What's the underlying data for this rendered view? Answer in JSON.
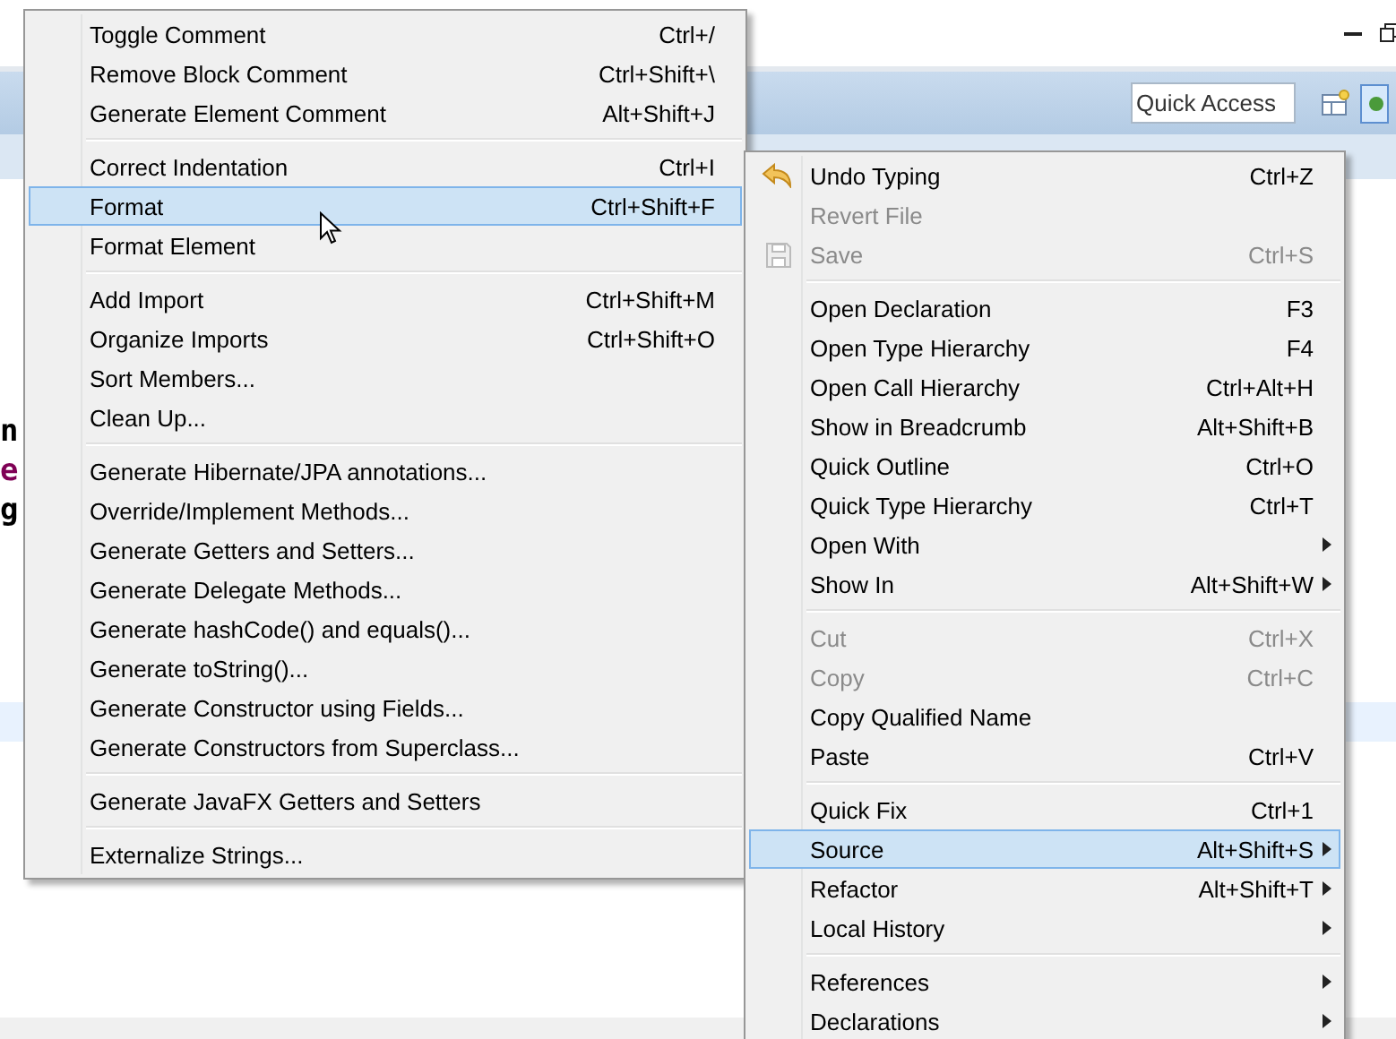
{
  "toolbar": {
    "quick_access": {
      "placeholder": "Quick Access"
    }
  },
  "editor": {
    "lines": [
      {
        "text": "n",
        "kind": "plain"
      },
      {
        "text": "e",
        "kind": "keyword"
      },
      {
        "text": "g",
        "kind": "plain"
      }
    ]
  },
  "menus": [
    {
      "items": [
        {
          "kind": "item",
          "label": "Toggle Comment",
          "shortcut": "Ctrl+/",
          "selected": false,
          "disabled": false,
          "submenu": false
        },
        {
          "kind": "item",
          "label": "Remove Block Comment",
          "shortcut": "Ctrl+Shift+\\",
          "selected": false,
          "disabled": false,
          "submenu": false
        },
        {
          "kind": "item",
          "label": "Generate Element Comment",
          "shortcut": "Alt+Shift+J",
          "selected": false,
          "disabled": false,
          "submenu": false
        },
        {
          "kind": "separator"
        },
        {
          "kind": "item",
          "label": "Correct Indentation",
          "shortcut": "Ctrl+I",
          "selected": false,
          "disabled": false,
          "submenu": false
        },
        {
          "kind": "item",
          "label": "Format",
          "shortcut": "Ctrl+Shift+F",
          "selected": true,
          "disabled": false,
          "submenu": false
        },
        {
          "kind": "item",
          "label": "Format Element",
          "selected": false,
          "disabled": false,
          "submenu": false
        },
        {
          "kind": "separator"
        },
        {
          "kind": "item",
          "label": "Add Import",
          "shortcut": "Ctrl+Shift+M",
          "selected": false,
          "disabled": false,
          "submenu": false
        },
        {
          "kind": "item",
          "label": "Organize Imports",
          "shortcut": "Ctrl+Shift+O",
          "selected": false,
          "disabled": false,
          "submenu": false
        },
        {
          "kind": "item",
          "label": "Sort Members...",
          "selected": false,
          "disabled": false,
          "submenu": false
        },
        {
          "kind": "item",
          "label": "Clean Up...",
          "selected": false,
          "disabled": false,
          "submenu": false
        },
        {
          "kind": "separator"
        },
        {
          "kind": "item",
          "label": "Generate Hibernate/JPA annotations...",
          "selected": false,
          "disabled": false,
          "submenu": false
        },
        {
          "kind": "item",
          "label": "Override/Implement Methods...",
          "selected": false,
          "disabled": false,
          "submenu": false
        },
        {
          "kind": "item",
          "label": "Generate Getters and Setters...",
          "selected": false,
          "disabled": false,
          "submenu": false
        },
        {
          "kind": "item",
          "label": "Generate Delegate Methods...",
          "selected": false,
          "disabled": false,
          "submenu": false
        },
        {
          "kind": "item",
          "label": "Generate hashCode() and equals()...",
          "selected": false,
          "disabled": false,
          "submenu": false
        },
        {
          "kind": "item",
          "label": "Generate toString()...",
          "selected": false,
          "disabled": false,
          "submenu": false
        },
        {
          "kind": "item",
          "label": "Generate Constructor using Fields...",
          "selected": false,
          "disabled": false,
          "submenu": false
        },
        {
          "kind": "item",
          "label": "Generate Constructors from Superclass...",
          "selected": false,
          "disabled": false,
          "submenu": false
        },
        {
          "kind": "separator"
        },
        {
          "kind": "item",
          "label": "Generate JavaFX Getters and Setters",
          "selected": false,
          "disabled": false,
          "submenu": false
        },
        {
          "kind": "separator"
        },
        {
          "kind": "item",
          "label": "Externalize Strings...",
          "selected": false,
          "disabled": false,
          "submenu": false
        }
      ]
    },
    {
      "items": [
        {
          "kind": "item",
          "label": "Undo Typing",
          "shortcut": "Ctrl+Z",
          "selected": false,
          "disabled": false,
          "submenu": false
        },
        {
          "kind": "item",
          "label": "Revert File",
          "selected": false,
          "disabled": true,
          "submenu": false
        },
        {
          "kind": "item",
          "label": "Save",
          "shortcut": "Ctrl+S",
          "selected": false,
          "disabled": true,
          "submenu": false
        },
        {
          "kind": "separator"
        },
        {
          "kind": "item",
          "label": "Open Declaration",
          "shortcut": "F3",
          "selected": false,
          "disabled": false,
          "submenu": false
        },
        {
          "kind": "item",
          "label": "Open Type Hierarchy",
          "shortcut": "F4",
          "selected": false,
          "disabled": false,
          "submenu": false
        },
        {
          "kind": "item",
          "label": "Open Call Hierarchy",
          "shortcut": "Ctrl+Alt+H",
          "selected": false,
          "disabled": false,
          "submenu": false
        },
        {
          "kind": "item",
          "label": "Show in Breadcrumb",
          "shortcut": "Alt+Shift+B",
          "selected": false,
          "disabled": false,
          "submenu": false
        },
        {
          "kind": "item",
          "label": "Quick Outline",
          "shortcut": "Ctrl+O",
          "selected": false,
          "disabled": false,
          "submenu": false
        },
        {
          "kind": "item",
          "label": "Quick Type Hierarchy",
          "shortcut": "Ctrl+T",
          "selected": false,
          "disabled": false,
          "submenu": false
        },
        {
          "kind": "item",
          "label": "Open With",
          "selected": false,
          "disabled": false,
          "submenu": true
        },
        {
          "kind": "item",
          "label": "Show In",
          "shortcut": "Alt+Shift+W",
          "selected": false,
          "disabled": false,
          "submenu": true
        },
        {
          "kind": "separator"
        },
        {
          "kind": "item",
          "label": "Cut",
          "shortcut": "Ctrl+X",
          "selected": false,
          "disabled": true,
          "submenu": false
        },
        {
          "kind": "item",
          "label": "Copy",
          "shortcut": "Ctrl+C",
          "selected": false,
          "disabled": true,
          "submenu": false
        },
        {
          "kind": "item",
          "label": "Copy Qualified Name",
          "selected": false,
          "disabled": false,
          "submenu": false
        },
        {
          "kind": "item",
          "label": "Paste",
          "shortcut": "Ctrl+V",
          "selected": false,
          "disabled": false,
          "submenu": false
        },
        {
          "kind": "separator"
        },
        {
          "kind": "item",
          "label": "Quick Fix",
          "shortcut": "Ctrl+1",
          "selected": false,
          "disabled": false,
          "submenu": false
        },
        {
          "kind": "item",
          "label": "Source",
          "shortcut": "Alt+Shift+S",
          "selected": true,
          "disabled": false,
          "submenu": true
        },
        {
          "kind": "item",
          "label": "Refactor",
          "shortcut": "Alt+Shift+T",
          "selected": false,
          "disabled": false,
          "submenu": true
        },
        {
          "kind": "item",
          "label": "Local History",
          "selected": false,
          "disabled": false,
          "submenu": true
        },
        {
          "kind": "separator"
        },
        {
          "kind": "item",
          "label": "References",
          "selected": false,
          "disabled": false,
          "submenu": true
        },
        {
          "kind": "item",
          "label": "Declarations",
          "selected": false,
          "disabled": false,
          "submenu": true
        }
      ]
    }
  ]
}
